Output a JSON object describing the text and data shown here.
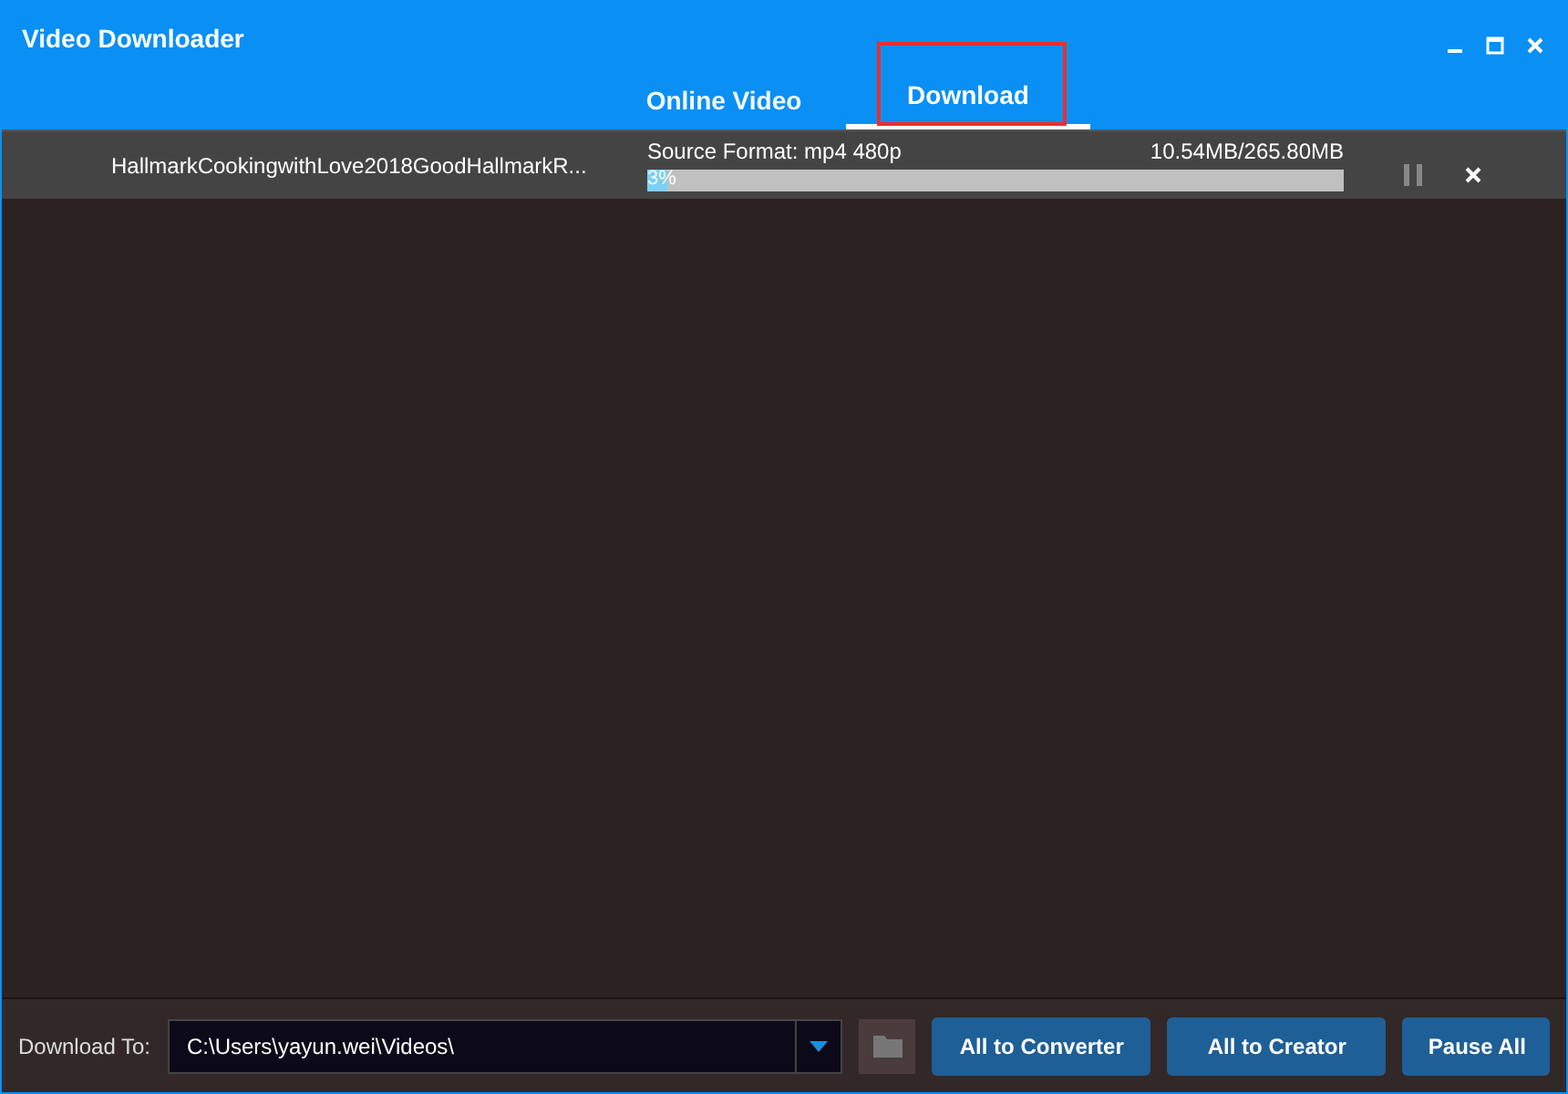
{
  "window": {
    "title": "Video Downloader"
  },
  "tabs": [
    {
      "label": "Online Video",
      "selected": false,
      "highlighted": false
    },
    {
      "label": "Download",
      "selected": true,
      "highlighted": true
    }
  ],
  "downloads": [
    {
      "name": "HallmarkCookingwithLove2018GoodHallmarkR...",
      "format": "Source Format: mp4 480p",
      "size": "10.54MB/265.80MB",
      "level": 0.03,
      "percent": "3%"
    }
  ],
  "footer": {
    "label": "Download To:",
    "path": "C:\\Users\\yayun.wei\\Videos\\",
    "buttons": [
      "All to Converter",
      "All to Creator",
      "Pause All"
    ]
  }
}
